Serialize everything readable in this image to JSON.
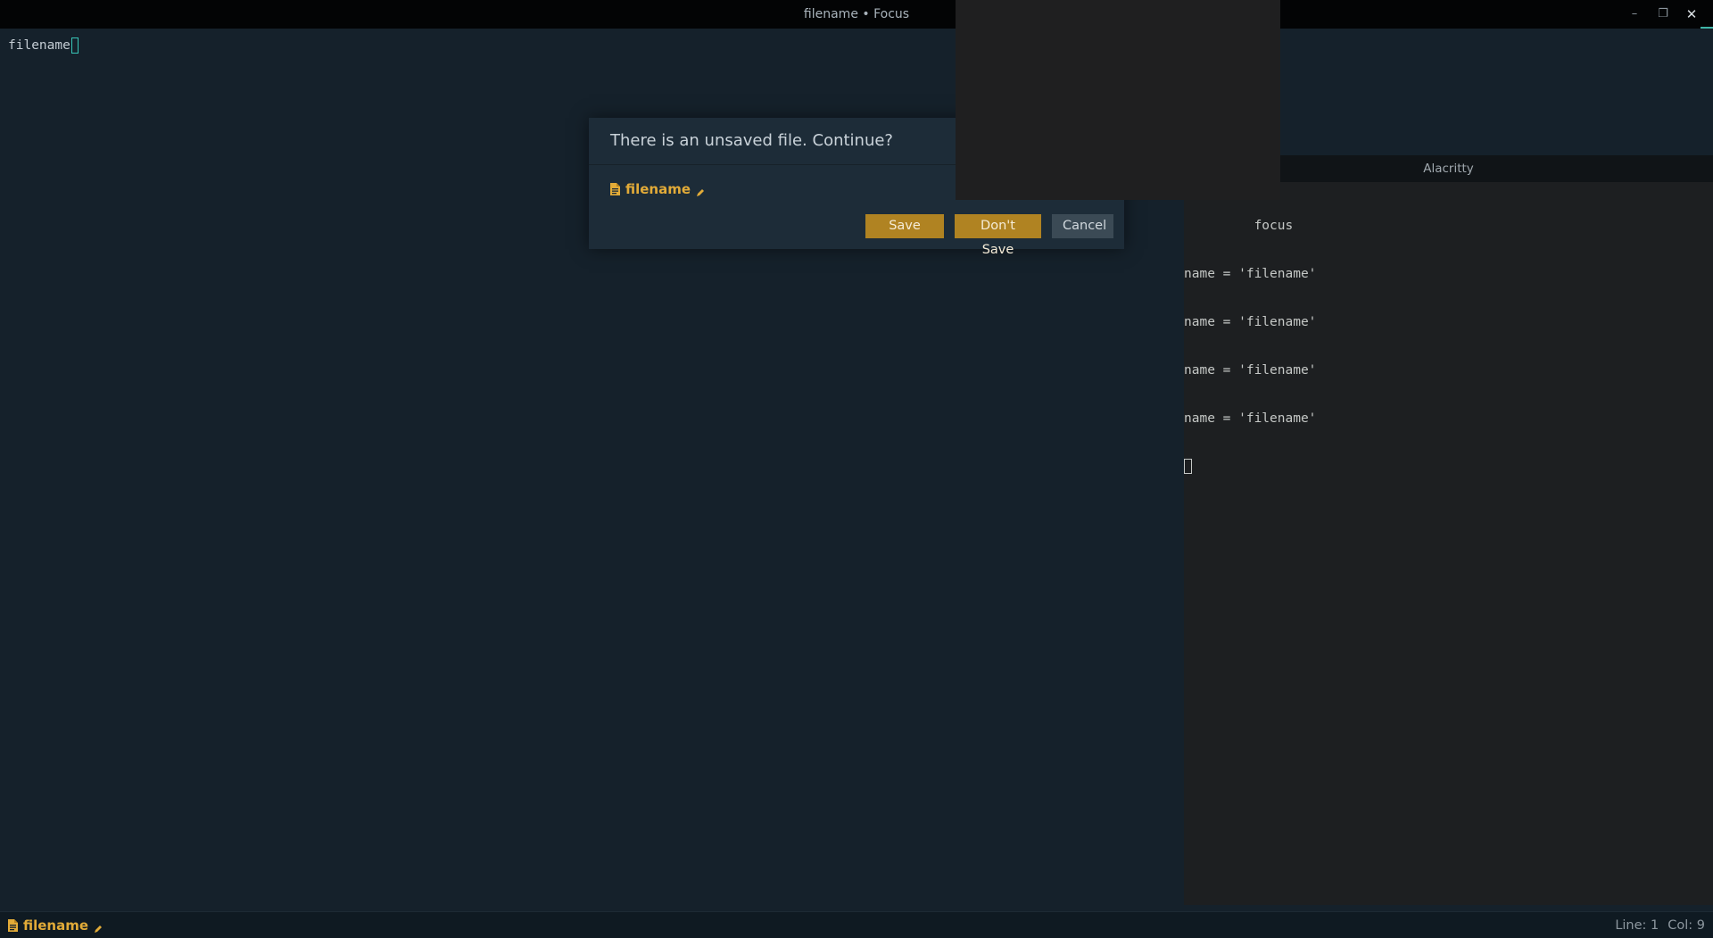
{
  "window": {
    "title": "filename • Focus",
    "controls": {
      "minimize": "–",
      "maximize": "❐",
      "close": "✕"
    }
  },
  "editor": {
    "line_text": "filename"
  },
  "dialog": {
    "title": "There is an unsaved file. Continue?",
    "file_name": "filename",
    "buttons": {
      "save": "Save",
      "dont_save": "Don't Save",
      "cancel": "Cancel"
    }
  },
  "statusbar": {
    "file_name": "filename",
    "line": "Line: 1",
    "col": "Col: 9"
  },
  "terminal": {
    "title": "Alacritty",
    "lines": [
      "         focus",
      "name = 'filename'",
      "name = 'filename'",
      "name = 'filename'",
      "name = 'filename'"
    ]
  },
  "colors": {
    "editor_bg": "#15212b",
    "accent_orange": "#e2ab38",
    "cursor_teal": "#38c5b6",
    "button_gold": "#b08322",
    "button_grey": "#3b4a55"
  },
  "icons": {
    "file": "file-icon",
    "pencil": "pencil-icon"
  }
}
